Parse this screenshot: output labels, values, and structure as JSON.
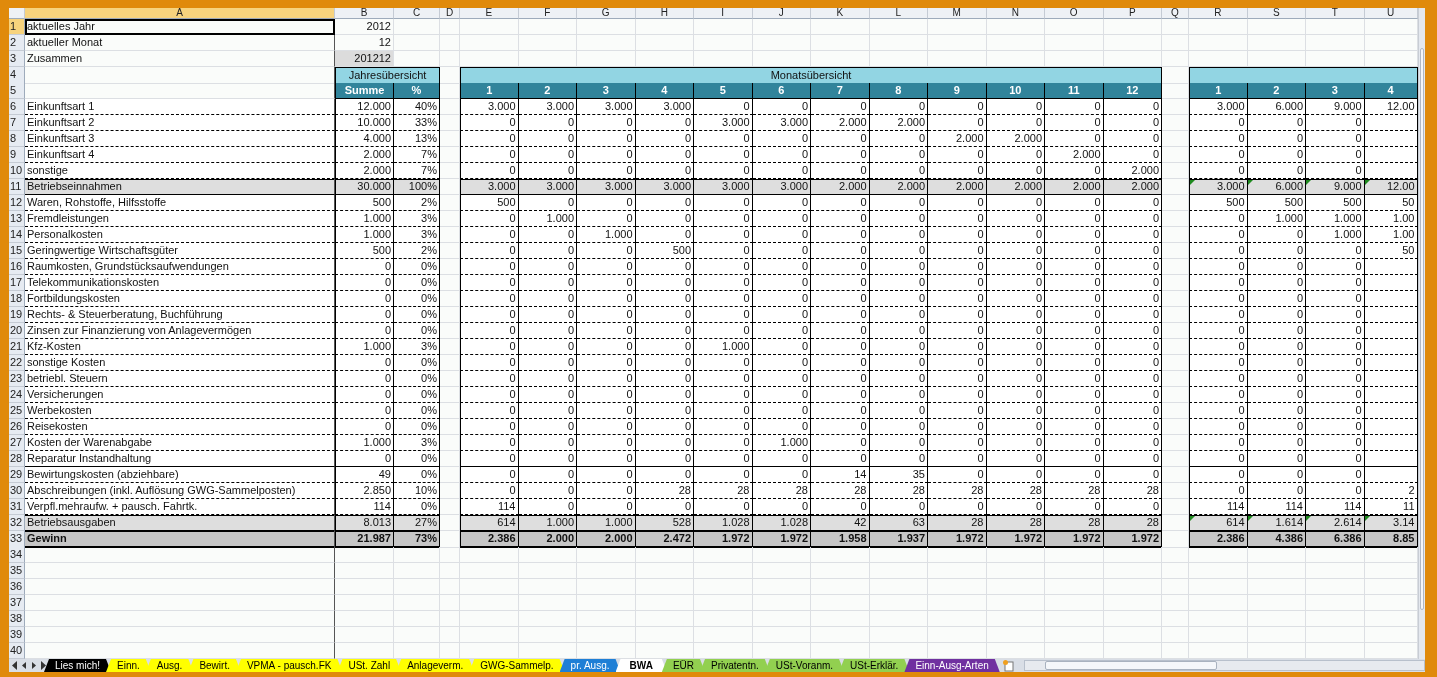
{
  "columns": [
    {
      "label": "A",
      "selected": true
    },
    {
      "label": "B",
      "selected": false
    },
    {
      "label": "C",
      "selected": false
    },
    {
      "label": "D",
      "selected": false
    },
    {
      "label": "E",
      "selected": false
    },
    {
      "label": "F",
      "selected": false
    },
    {
      "label": "G",
      "selected": false
    },
    {
      "label": "H",
      "selected": false
    },
    {
      "label": "I",
      "selected": false
    },
    {
      "label": "J",
      "selected": false
    },
    {
      "label": "K",
      "selected": false
    },
    {
      "label": "L",
      "selected": false
    },
    {
      "label": "M",
      "selected": false
    },
    {
      "label": "N",
      "selected": false
    },
    {
      "label": "O",
      "selected": false
    },
    {
      "label": "P",
      "selected": false
    },
    {
      "label": "Q",
      "selected": false
    },
    {
      "label": "R",
      "selected": false
    },
    {
      "label": "S",
      "selected": false
    },
    {
      "label": "T",
      "selected": false
    },
    {
      "label": "U",
      "selected": false
    }
  ],
  "rows": [
    {
      "number": "1",
      "kind": "info",
      "label": "aktuelles Jahr",
      "value": "2012",
      "shaded": false,
      "selected": true
    },
    {
      "number": "2",
      "kind": "info",
      "label": "aktueller Monat",
      "value": "12",
      "shaded": false,
      "selected": false
    },
    {
      "number": "3",
      "kind": "info",
      "label": "Zusammen",
      "value": "201212",
      "shaded": true,
      "selected": false
    },
    {
      "number": "4",
      "kind": "section",
      "year_title": "Jahresübersicht",
      "month_title": "Monatsübersicht",
      "selected": false
    },
    {
      "number": "5",
      "kind": "header",
      "sum": "Summe",
      "pct": "%",
      "months": [
        "1",
        "2",
        "3",
        "4",
        "5",
        "6",
        "7",
        "8",
        "9",
        "10",
        "11",
        "12"
      ],
      "cumulative": [
        "1",
        "2",
        "3",
        "4"
      ],
      "selected": false
    },
    {
      "number": "6",
      "kind": "item",
      "label": "Einkunftsart 1",
      "sum": "12.000",
      "pct": "40%",
      "months": [
        "3.000",
        "3.000",
        "3.000",
        "3.000",
        "0",
        "0",
        "0",
        "0",
        "0",
        "0",
        "0",
        "0"
      ],
      "cumulative": [
        "3.000",
        "6.000",
        "9.000",
        "12.00"
      ],
      "selected": false
    },
    {
      "number": "7",
      "kind": "item",
      "label": "Einkunftsart 2",
      "sum": "10.000",
      "pct": "33%",
      "months": [
        "0",
        "0",
        "0",
        "0",
        "3.000",
        "3.000",
        "2.000",
        "2.000",
        "0",
        "0",
        "0",
        "0"
      ],
      "cumulative": [
        "0",
        "0",
        "0"
      ],
      "selected": false
    },
    {
      "number": "8",
      "kind": "item",
      "label": "Einkunftsart 3",
      "sum": "4.000",
      "pct": "13%",
      "months": [
        "0",
        "0",
        "0",
        "0",
        "0",
        "0",
        "0",
        "0",
        "2.000",
        "2.000",
        "0",
        "0"
      ],
      "cumulative": [
        "0",
        "0",
        "0"
      ],
      "selected": false
    },
    {
      "number": "9",
      "kind": "item",
      "label": "Einkunftsart 4",
      "sum": "2.000",
      "pct": "7%",
      "months": [
        "0",
        "0",
        "0",
        "0",
        "0",
        "0",
        "0",
        "0",
        "0",
        "0",
        "2.000",
        "0"
      ],
      "cumulative": [
        "0",
        "0",
        "0"
      ],
      "selected": false
    },
    {
      "number": "10",
      "kind": "item",
      "label": "sonstige",
      "sum": "2.000",
      "pct": "7%",
      "months": [
        "0",
        "0",
        "0",
        "0",
        "0",
        "0",
        "0",
        "0",
        "0",
        "0",
        "0",
        "2.000"
      ],
      "cumulative": [
        "0",
        "0",
        "0"
      ],
      "selected": false
    },
    {
      "number": "11",
      "kind": "subtotal",
      "label": "Betriebseinnahmen",
      "sum": "30.000",
      "pct": "100%",
      "months": [
        "3.000",
        "3.000",
        "3.000",
        "3.000",
        "3.000",
        "3.000",
        "2.000",
        "2.000",
        "2.000",
        "2.000",
        "2.000",
        "2.000"
      ],
      "cumulative": [
        "3.000",
        "6.000",
        "9.000",
        "12.00"
      ],
      "selected": false
    },
    {
      "number": "12",
      "kind": "item",
      "label": "Waren, Rohstoffe, Hilfsstoffe",
      "sum": "500",
      "pct": "2%",
      "months": [
        "500",
        "0",
        "0",
        "0",
        "0",
        "0",
        "0",
        "0",
        "0",
        "0",
        "0",
        "0"
      ],
      "cumulative": [
        "500",
        "500",
        "500",
        "50"
      ],
      "selected": false
    },
    {
      "number": "13",
      "kind": "item",
      "label": "Fremdleistungen",
      "sum": "1.000",
      "pct": "3%",
      "months": [
        "0",
        "1.000",
        "0",
        "0",
        "0",
        "0",
        "0",
        "0",
        "0",
        "0",
        "0",
        "0"
      ],
      "cumulative": [
        "0",
        "1.000",
        "1.000",
        "1.00"
      ],
      "selected": false
    },
    {
      "number": "14",
      "kind": "item",
      "label": "Personalkosten",
      "sum": "1.000",
      "pct": "3%",
      "months": [
        "0",
        "0",
        "1.000",
        "0",
        "0",
        "0",
        "0",
        "0",
        "0",
        "0",
        "0",
        "0"
      ],
      "cumulative": [
        "0",
        "0",
        "1.000",
        "1.00"
      ],
      "selected": false
    },
    {
      "number": "15",
      "kind": "item",
      "label": "Geringwertige Wirtschaftsgüter",
      "sum": "500",
      "pct": "2%",
      "months": [
        "0",
        "0",
        "0",
        "500",
        "0",
        "0",
        "0",
        "0",
        "0",
        "0",
        "0",
        "0"
      ],
      "cumulative": [
        "0",
        "0",
        "0",
        "50"
      ],
      "selected": false
    },
    {
      "number": "16",
      "kind": "item",
      "label": "Raumkosten, Grundstücksaufwendungen",
      "sum": "0",
      "pct": "0%",
      "months": [
        "0",
        "0",
        "0",
        "0",
        "0",
        "0",
        "0",
        "0",
        "0",
        "0",
        "0",
        "0"
      ],
      "cumulative": [
        "0",
        "0",
        "0"
      ],
      "selected": false
    },
    {
      "number": "17",
      "kind": "item",
      "label": "Telekommunikationskosten",
      "sum": "0",
      "pct": "0%",
      "months": [
        "0",
        "0",
        "0",
        "0",
        "0",
        "0",
        "0",
        "0",
        "0",
        "0",
        "0",
        "0"
      ],
      "cumulative": [
        "0",
        "0",
        "0"
      ],
      "selected": false
    },
    {
      "number": "18",
      "kind": "item",
      "label": "Fortbildungskosten",
      "sum": "0",
      "pct": "0%",
      "months": [
        "0",
        "0",
        "0",
        "0",
        "0",
        "0",
        "0",
        "0",
        "0",
        "0",
        "0",
        "0"
      ],
      "cumulative": [
        "0",
        "0",
        "0"
      ],
      "selected": false
    },
    {
      "number": "19",
      "kind": "item",
      "label": "Rechts- & Steuerberatung, Buchführung",
      "sum": "0",
      "pct": "0%",
      "months": [
        "0",
        "0",
        "0",
        "0",
        "0",
        "0",
        "0",
        "0",
        "0",
        "0",
        "0",
        "0"
      ],
      "cumulative": [
        "0",
        "0",
        "0"
      ],
      "selected": false
    },
    {
      "number": "20",
      "kind": "item",
      "label": "Zinsen zur Finanzierung von Anlagevermögen",
      "sum": "0",
      "pct": "0%",
      "months": [
        "0",
        "0",
        "0",
        "0",
        "0",
        "0",
        "0",
        "0",
        "0",
        "0",
        "0",
        "0"
      ],
      "cumulative": [
        "0",
        "0",
        "0"
      ],
      "selected": false
    },
    {
      "number": "21",
      "kind": "item",
      "label": "Kfz-Kosten",
      "sum": "1.000",
      "pct": "3%",
      "months": [
        "0",
        "0",
        "0",
        "0",
        "1.000",
        "0",
        "0",
        "0",
        "0",
        "0",
        "0",
        "0"
      ],
      "cumulative": [
        "0",
        "0",
        "0"
      ],
      "selected": false
    },
    {
      "number": "22",
      "kind": "item",
      "label": "sonstige Kosten",
      "sum": "0",
      "pct": "0%",
      "months": [
        "0",
        "0",
        "0",
        "0",
        "0",
        "0",
        "0",
        "0",
        "0",
        "0",
        "0",
        "0"
      ],
      "cumulative": [
        "0",
        "0",
        "0"
      ],
      "selected": false
    },
    {
      "number": "23",
      "kind": "item",
      "label": "betriebl. Steuern",
      "sum": "0",
      "pct": "0%",
      "months": [
        "0",
        "0",
        "0",
        "0",
        "0",
        "0",
        "0",
        "0",
        "0",
        "0",
        "0",
        "0"
      ],
      "cumulative": [
        "0",
        "0",
        "0"
      ],
      "selected": false
    },
    {
      "number": "24",
      "kind": "item",
      "label": "Versicherungen",
      "sum": "0",
      "pct": "0%",
      "months": [
        "0",
        "0",
        "0",
        "0",
        "0",
        "0",
        "0",
        "0",
        "0",
        "0",
        "0",
        "0"
      ],
      "cumulative": [
        "0",
        "0",
        "0"
      ],
      "selected": false
    },
    {
      "number": "25",
      "kind": "item",
      "label": "Werbekosten",
      "sum": "0",
      "pct": "0%",
      "months": [
        "0",
        "0",
        "0",
        "0",
        "0",
        "0",
        "0",
        "0",
        "0",
        "0",
        "0",
        "0"
      ],
      "cumulative": [
        "0",
        "0",
        "0"
      ],
      "selected": false
    },
    {
      "number": "26",
      "kind": "item",
      "label": "Reisekosten",
      "sum": "0",
      "pct": "0%",
      "months": [
        "0",
        "0",
        "0",
        "0",
        "0",
        "0",
        "0",
        "0",
        "0",
        "0",
        "0",
        "0"
      ],
      "cumulative": [
        "0",
        "0",
        "0"
      ],
      "selected": false
    },
    {
      "number": "27",
      "kind": "item",
      "label": "Kosten der Warenabgabe",
      "sum": "1.000",
      "pct": "3%",
      "months": [
        "0",
        "0",
        "0",
        "0",
        "0",
        "1.000",
        "0",
        "0",
        "0",
        "0",
        "0",
        "0"
      ],
      "cumulative": [
        "0",
        "0",
        "0"
      ],
      "selected": false
    },
    {
      "number": "28",
      "kind": "item",
      "label": "Reparatur Instandhaltung",
      "sum": "0",
      "pct": "0%",
      "months": [
        "0",
        "0",
        "0",
        "0",
        "0",
        "0",
        "0",
        "0",
        "0",
        "0",
        "0",
        "0"
      ],
      "cumulative": [
        "0",
        "0",
        "0"
      ],
      "group_end": true,
      "selected": false
    },
    {
      "number": "29",
      "kind": "item",
      "label": "Bewirtungskosten (abziehbare)",
      "sum": "49",
      "pct": "0%",
      "months": [
        "0",
        "0",
        "0",
        "0",
        "0",
        "0",
        "14",
        "35",
        "0",
        "0",
        "0",
        "0"
      ],
      "cumulative": [
        "0",
        "0",
        "0"
      ],
      "selected": false
    },
    {
      "number": "30",
      "kind": "item",
      "label": "Abschreibungen (inkl. Auflösung GWG-Sammelposten)",
      "sum": "2.850",
      "pct": "10%",
      "months": [
        "0",
        "0",
        "0",
        "28",
        "28",
        "28",
        "28",
        "28",
        "28",
        "28",
        "28",
        "28"
      ],
      "cumulative": [
        "0",
        "0",
        "0",
        "2"
      ],
      "selected": false
    },
    {
      "number": "31",
      "kind": "item",
      "label": "Verpfl.mehraufw. + pausch. Fahrtk.",
      "sum": "114",
      "pct": "0%",
      "months": [
        "114",
        "0",
        "0",
        "0",
        "0",
        "0",
        "0",
        "0",
        "0",
        "0",
        "0",
        "0"
      ],
      "cumulative": [
        "114",
        "114",
        "114",
        "11"
      ],
      "selected": false
    },
    {
      "number": "32",
      "kind": "subtotal",
      "label": "Betriebsausgaben",
      "sum": "8.013",
      "pct": "27%",
      "months": [
        "614",
        "1.000",
        "1.000",
        "528",
        "1.028",
        "1.028",
        "42",
        "63",
        "28",
        "28",
        "28",
        "28"
      ],
      "cumulative": [
        "614",
        "1.614",
        "2.614",
        "3.14"
      ],
      "selected": false
    },
    {
      "number": "33",
      "kind": "total",
      "label": "Gewinn",
      "sum": "21.987",
      "pct": "73%",
      "months": [
        "2.386",
        "2.000",
        "2.000",
        "2.472",
        "1.972",
        "1.972",
        "1.958",
        "1.937",
        "1.972",
        "1.972",
        "1.972",
        "1.972"
      ],
      "cumulative": [
        "2.386",
        "4.386",
        "6.386",
        "8.85"
      ],
      "selected": false
    },
    {
      "number": "34",
      "kind": "empty",
      "selected": false
    },
    {
      "number": "35",
      "kind": "empty",
      "selected": false
    },
    {
      "number": "36",
      "kind": "empty",
      "selected": false
    },
    {
      "number": "37",
      "kind": "empty",
      "selected": false
    },
    {
      "number": "38",
      "kind": "empty",
      "selected": false
    },
    {
      "number": "39",
      "kind": "empty",
      "selected": false
    },
    {
      "number": "40",
      "kind": "empty",
      "selected": false
    }
  ],
  "sheet_tabs": [
    {
      "label": "Lies mich!",
      "color": "#000000",
      "selected": false
    },
    {
      "label": "Einn.",
      "color": "#ffff00",
      "selected": false
    },
    {
      "label": "Ausg.",
      "color": "#ffff00",
      "selected": false
    },
    {
      "label": "Bewirt.",
      "color": "#ffff00",
      "selected": false
    },
    {
      "label": "VPMA - pausch.FK",
      "color": "#ffff00",
      "selected": false
    },
    {
      "label": "USt. Zahl",
      "color": "#ffff00",
      "selected": false
    },
    {
      "label": "Anlageverm.",
      "color": "#ffff00",
      "selected": false
    },
    {
      "label": "GWG-Sammelp.",
      "color": "#ffff00",
      "selected": false
    },
    {
      "label": "pr. Ausg.",
      "color": "#1e7fd6",
      "selected": false
    },
    {
      "label": "BWA",
      "color": "#ffffff",
      "selected": true
    },
    {
      "label": "EÜR",
      "color": "#92d050",
      "selected": false
    },
    {
      "label": "Privatentn.",
      "color": "#92d050",
      "selected": false
    },
    {
      "label": "USt-Voranm.",
      "color": "#92d050",
      "selected": false
    },
    {
      "label": "USt-Erklär.",
      "color": "#92d050",
      "selected": false
    },
    {
      "label": "Einn-Ausg-Arten",
      "color": "#7030a0",
      "selected": false
    }
  ]
}
